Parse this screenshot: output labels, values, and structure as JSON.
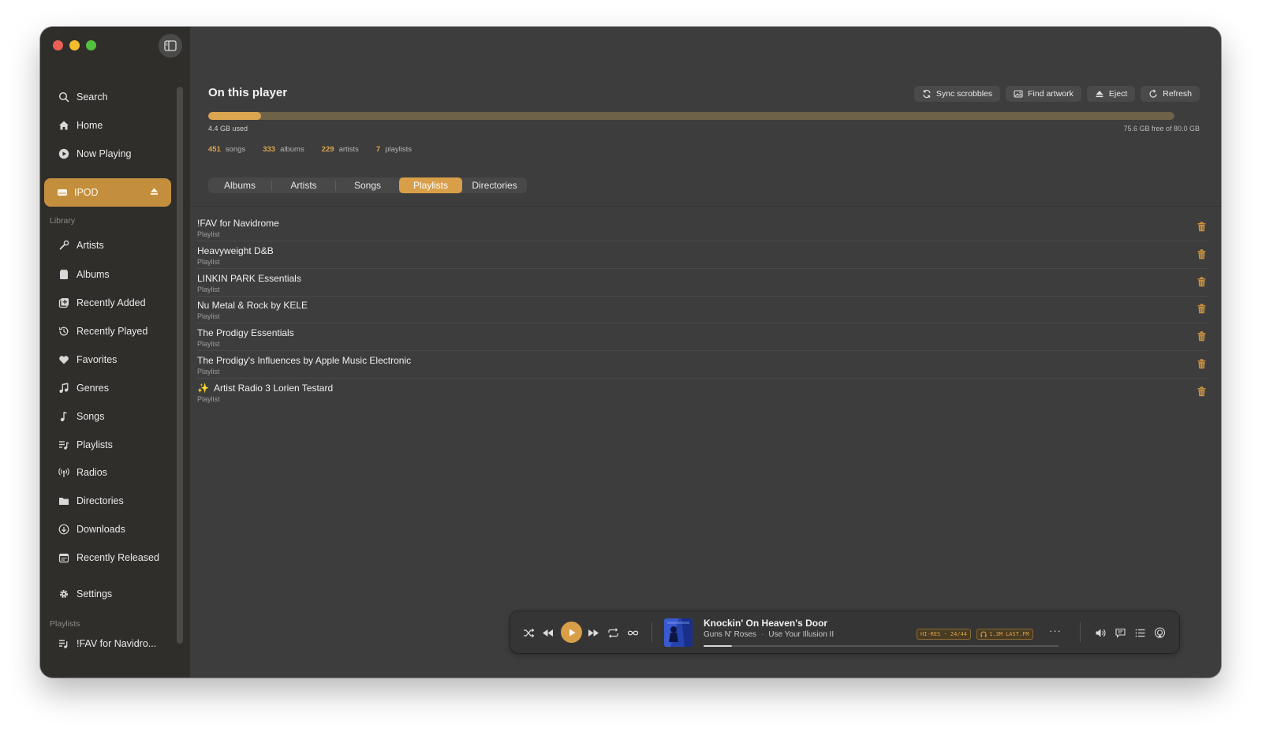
{
  "sidebar": {
    "nav": [
      {
        "label": "Search",
        "icon": "search-icon"
      },
      {
        "label": "Home",
        "icon": "home-icon"
      },
      {
        "label": "Now Playing",
        "icon": "play-circle-icon"
      }
    ],
    "device": {
      "label": "IPOD",
      "icon": "drive-icon"
    },
    "library_title": "Library",
    "library": [
      {
        "label": "Artists",
        "icon": "microphone-icon"
      },
      {
        "label": "Albums",
        "icon": "album-icon"
      },
      {
        "label": "Recently Added",
        "icon": "recently-added-icon"
      },
      {
        "label": "Recently Played",
        "icon": "history-icon"
      },
      {
        "label": "Favorites",
        "icon": "heart-icon"
      },
      {
        "label": "Genres",
        "icon": "genres-icon"
      },
      {
        "label": "Songs",
        "icon": "music-note-icon"
      },
      {
        "label": "Playlists",
        "icon": "playlist-icon"
      },
      {
        "label": "Radios",
        "icon": "radio-icon"
      },
      {
        "label": "Directories",
        "icon": "folder-icon"
      },
      {
        "label": "Downloads",
        "icon": "download-icon"
      },
      {
        "label": "Recently Released",
        "icon": "calendar-icon"
      }
    ],
    "settings": {
      "label": "Settings",
      "icon": "gear-icon"
    },
    "playlists_title": "Playlists",
    "playlists": [
      {
        "label": "!FAV for Navidro...",
        "icon": "playlist-icon"
      }
    ]
  },
  "header": {
    "title": "On this player",
    "buttons": {
      "sync": "Sync scrobbles",
      "artwork": "Find artwork",
      "eject": "Eject",
      "refresh": "Refresh"
    }
  },
  "storage": {
    "used_text": "4.4 GB used",
    "free_text": "75.6 GB free of 80.0 GB",
    "used_fraction": 0.055
  },
  "stats": [
    {
      "num": "451",
      "label": "songs"
    },
    {
      "num": "333",
      "label": "albums"
    },
    {
      "num": "229",
      "label": "artists"
    },
    {
      "num": "7",
      "label": "playlists"
    }
  ],
  "tabs": [
    "Albums",
    "Artists",
    "Songs",
    "Playlists",
    "Directories"
  ],
  "active_tab": "Playlists",
  "playlists": [
    {
      "name": "!FAV for Navidrome",
      "type": "Playlist"
    },
    {
      "name": "Heavyweight D&B",
      "type": "Playlist"
    },
    {
      "name": "LINKIN PARK Essentials",
      "type": "Playlist"
    },
    {
      "name": "Nu Metal & Rock by KELE",
      "type": "Playlist"
    },
    {
      "name": "The Prodigy Essentials",
      "type": "Playlist"
    },
    {
      "name": "The Prodigy's Influences by Apple Music Electronic",
      "type": "Playlist"
    },
    {
      "name": "Artist Radio 3 Lorien Testard",
      "type": "Playlist",
      "prefix": "✨"
    }
  ],
  "player": {
    "title": "Knockin' On Heaven's Door",
    "artist": "Guns N' Roses",
    "album": "Use Your Illusion II",
    "quality_badge": "HI-RES · 24/44",
    "listeners_badge": "1.3M LAST.FM",
    "progress_fraction": 0.08,
    "more": "···"
  },
  "colors": {
    "accent": "#d99f48",
    "sidebar_bg": "#2f2e2b",
    "main_bg": "#3d3d3d",
    "delete_icon": "#c8913f"
  }
}
